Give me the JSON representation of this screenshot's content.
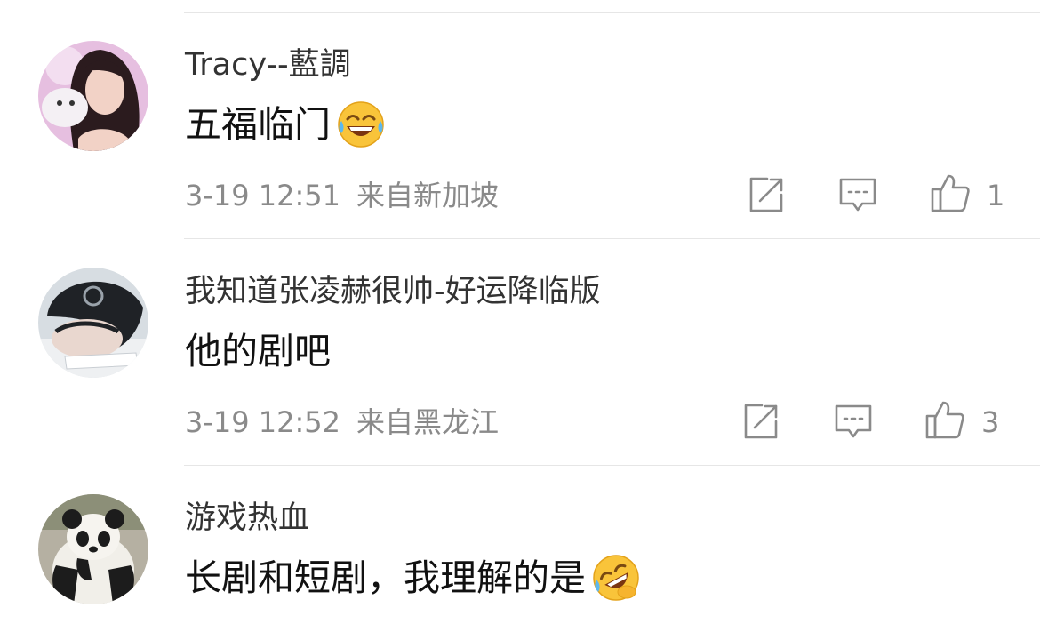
{
  "comments": [
    {
      "username": "Tracy--藍調",
      "text": "五福临门",
      "emoji": "laughing-tears-emoji",
      "time": "3-19 12:51",
      "source": "来自新加坡",
      "likes": "1"
    },
    {
      "username": "我知道张凌赫很帅-好运降临版",
      "text": "他的剧吧",
      "time": "3-19 12:52",
      "source": "来自黑龙江",
      "likes": "3"
    },
    {
      "username": "游戏热血",
      "text": "长剧和短剧，我理解的是",
      "emoji": "rolling-laughing-emoji"
    }
  ],
  "icons": {
    "share": "share-icon",
    "reply": "comment-icon",
    "like": "thumbs-up-icon"
  },
  "colors": {
    "username": "#333333",
    "body": "#111111",
    "meta": "#8a8a8a",
    "divider": "#e6e6e6"
  }
}
